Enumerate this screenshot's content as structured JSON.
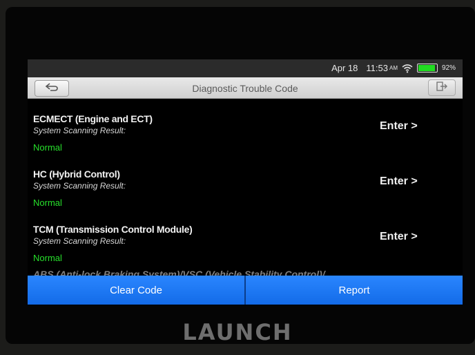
{
  "status_bar": {
    "date": "Apr 18",
    "time": "11:53",
    "ampm": "AM",
    "battery_percent": "92%",
    "battery_level": 0.92
  },
  "title_bar": {
    "title": "Diagnostic Trouble Code",
    "back_icon": "back-arrow-icon",
    "exit_icon": "exit-icon"
  },
  "systems": [
    {
      "name": "ECMECT (Engine and ECT)",
      "scan_label": "System Scanning Result:",
      "status": "Normal",
      "action": "Enter >"
    },
    {
      "name": "HC (Hybrid Control)",
      "scan_label": "System Scanning Result:",
      "status": "Normal",
      "action": "Enter >"
    },
    {
      "name": "TCM (Transmission Control Module)",
      "scan_label": "System Scanning Result:",
      "status": "Normal",
      "action": "Enter >"
    }
  ],
  "partial_system": "ABS (Anti-lock Braking System)/VSC (Vehicle Stability Control)/",
  "buttons": {
    "clear_code": "Clear Code",
    "report": "Report"
  },
  "brand": "LAUNCH",
  "colors": {
    "normal_status": "#27e02b",
    "button_blue": "#1a76f5"
  }
}
